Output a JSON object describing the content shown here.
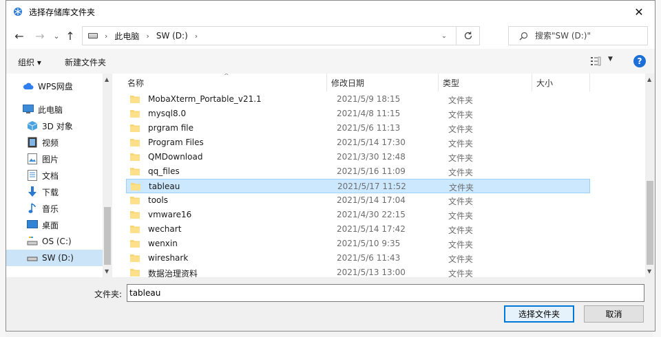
{
  "window": {
    "title": "选择存储库文件夹",
    "close_glyph": "✕"
  },
  "nav": {
    "back_glyph": "←",
    "forward_glyph": "→",
    "recent_glyph": "⌄",
    "up_glyph": "↑",
    "breadcrumb": [
      "此电脑",
      "SW (D:)"
    ],
    "breadcrumb_sep": "›",
    "search_placeholder": "搜索\"SW (D:)\""
  },
  "toolbar": {
    "organize": "组织 ▾",
    "new_folder": "新建文件夹",
    "help": "?"
  },
  "sidebar": {
    "items": [
      {
        "label": "WPS网盘",
        "icon": "cloud-icon"
      },
      {
        "label": "此电脑",
        "icon": "computer-icon"
      },
      {
        "label": "3D 对象",
        "icon": "cube-icon"
      },
      {
        "label": "视频",
        "icon": "video-icon"
      },
      {
        "label": "图片",
        "icon": "picture-icon"
      },
      {
        "label": "文档",
        "icon": "document-icon"
      },
      {
        "label": "下载",
        "icon": "download-icon"
      },
      {
        "label": "音乐",
        "icon": "music-icon"
      },
      {
        "label": "桌面",
        "icon": "desktop-icon"
      },
      {
        "label": "OS (C:)",
        "icon": "drive-c-icon"
      },
      {
        "label": "SW (D:)",
        "icon": "drive-d-icon",
        "selected": true
      }
    ]
  },
  "files": {
    "columns": {
      "name": "名称",
      "modified": "修改日期",
      "type": "类型",
      "size": "大小"
    },
    "rows": [
      {
        "name": "MobaXterm_Portable_v21.1",
        "modified": "2021/5/9 18:15",
        "type": "文件夹"
      },
      {
        "name": "mysql8.0",
        "modified": "2021/4/8 11:15",
        "type": "文件夹"
      },
      {
        "name": "prgram file",
        "modified": "2021/5/6 11:13",
        "type": "文件夹"
      },
      {
        "name": "Program Files",
        "modified": "2021/5/14 17:30",
        "type": "文件夹"
      },
      {
        "name": "QMDownload",
        "modified": "2021/3/30 12:48",
        "type": "文件夹"
      },
      {
        "name": "qq_files",
        "modified": "2021/5/16 11:09",
        "type": "文件夹"
      },
      {
        "name": "tableau",
        "modified": "2021/5/17 11:52",
        "type": "文件夹",
        "selected": true
      },
      {
        "name": "tools",
        "modified": "2021/5/14 17:04",
        "type": "文件夹"
      },
      {
        "name": "vmware16",
        "modified": "2021/4/30 22:15",
        "type": "文件夹"
      },
      {
        "name": "wechart",
        "modified": "2021/5/14 17:42",
        "type": "文件夹"
      },
      {
        "name": "wenxin",
        "modified": "2021/5/10 9:35",
        "type": "文件夹"
      },
      {
        "name": "wireshark",
        "modified": "2021/5/6 11:43",
        "type": "文件夹"
      },
      {
        "name": "数据治理资料",
        "modified": "2021/5/13 13:00",
        "type": "文件夹"
      }
    ]
  },
  "footer": {
    "folder_label": "文件夹:",
    "folder_value": "tableau",
    "select_button": "选择文件夹",
    "cancel_button": "取消"
  },
  "colors": {
    "accent": "#0078d7",
    "selection": "#cce8ff",
    "folder": "#f8d775"
  }
}
